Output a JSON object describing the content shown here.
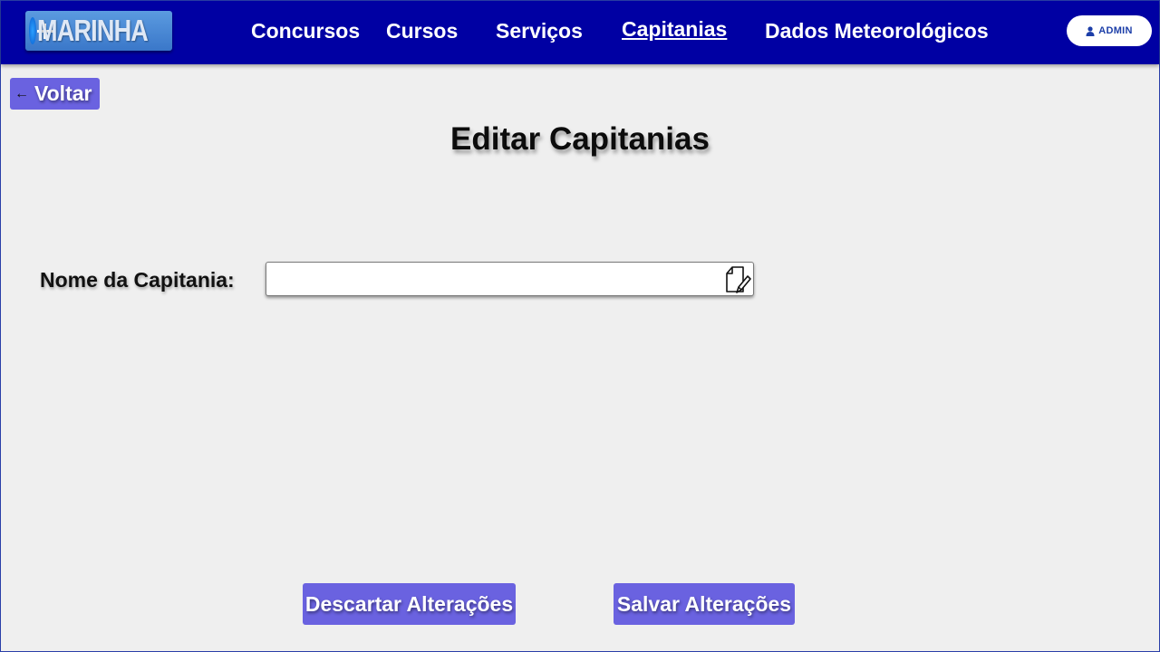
{
  "header": {
    "logo_text": "MARINHA",
    "nav": [
      {
        "label": "Concursos"
      },
      {
        "label": "Cursos"
      },
      {
        "label": "Serviços"
      },
      {
        "label": "Capitanias",
        "active": true
      },
      {
        "label": "Dados Meteorológicos"
      }
    ],
    "admin_label": "ADMIN",
    "user_icon": "user-icon"
  },
  "back": {
    "arrow": "←",
    "label": "Voltar"
  },
  "page": {
    "title": "Editar Capitanias"
  },
  "form": {
    "name_label": "Nome da Capitania:",
    "name_value": "",
    "name_icon": "edit-document-icon"
  },
  "actions": {
    "discard_label": "Descartar Alterações",
    "save_label": "Salvar Alterações"
  },
  "colors": {
    "navbar": "#0000a3",
    "button": "#6a62e0",
    "background": "#efefef"
  }
}
